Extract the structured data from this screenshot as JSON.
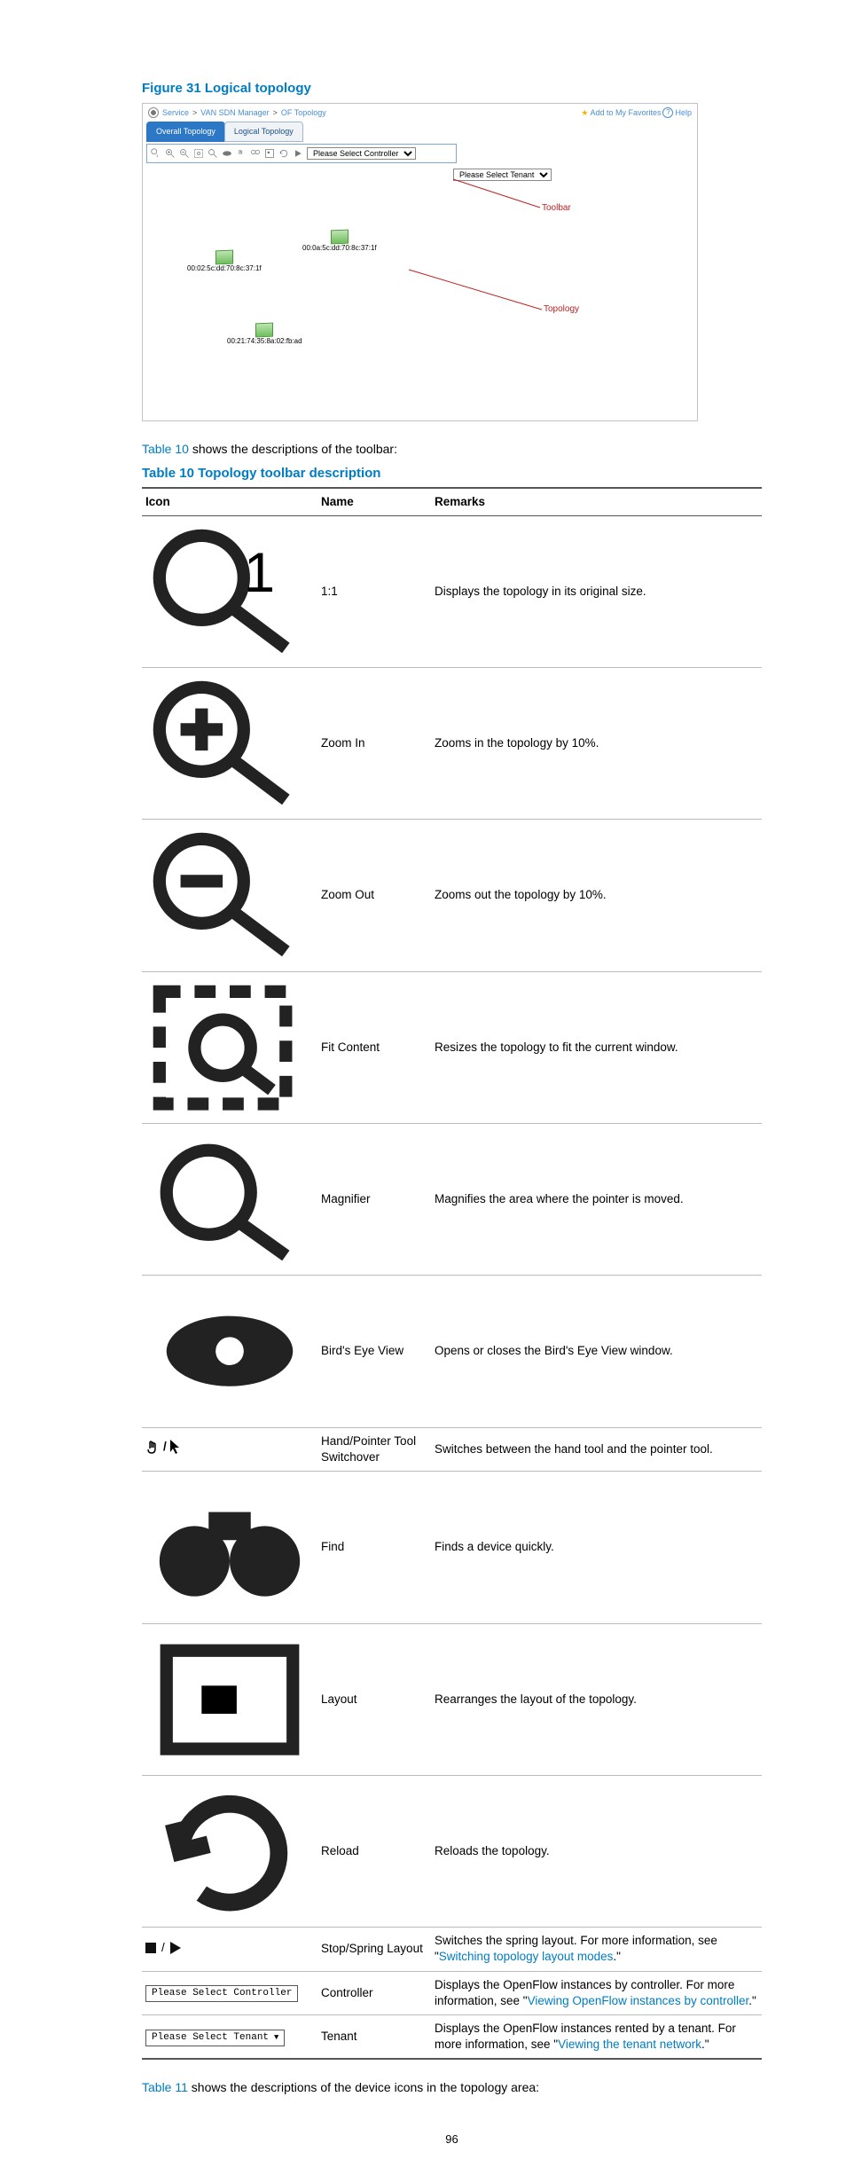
{
  "figure": {
    "label": "Figure 31 Logical topology"
  },
  "screenshot": {
    "breadcrumb": [
      "Service",
      "VAN SDN Manager",
      "OF Topology"
    ],
    "favorites_label": "Add to My Favorites",
    "help_label": "Help",
    "tabs": {
      "overall": "Overall Topology",
      "logical": "Logical Topology"
    },
    "controller_placeholder": "Please Select Controller",
    "tenant_placeholder": "Please Select Tenant",
    "nodes": {
      "a": "00:02:5c:dd:70:8c:37:1f",
      "b": "00:0a:5c:dd:70:8c:37:1f",
      "c": "00:21:74:35:8a:02:fb:ad"
    },
    "callouts": {
      "toolbar": "Toolbar",
      "topology": "Topology"
    }
  },
  "intro_para": {
    "link": "Table 10",
    "rest": " shows the descriptions of the toolbar:"
  },
  "table_title": "Table 10 Topology toolbar description",
  "table_headers": {
    "icon": "Icon",
    "name": "Name",
    "remarks": "Remarks"
  },
  "rows": [
    {
      "name": "1:1",
      "remarks": "Displays the topology in its original size."
    },
    {
      "name": "Zoom In",
      "remarks": "Zooms in the topology by 10%."
    },
    {
      "name": "Zoom Out",
      "remarks": "Zooms out the topology by 10%."
    },
    {
      "name": "Fit Content",
      "remarks": "Resizes the topology to fit the current window."
    },
    {
      "name": "Magnifier",
      "remarks": "Magnifies the area where the pointer is moved."
    },
    {
      "name": "Bird's Eye View",
      "remarks": "Opens or closes the Bird's Eye View window."
    },
    {
      "name": "Hand/Pointer Tool Switchover",
      "remarks": "Switches between the hand tool and the pointer tool."
    },
    {
      "name": "Find",
      "remarks": "Finds a device quickly."
    },
    {
      "name": "Layout",
      "remarks": "Rearranges the layout of the topology."
    },
    {
      "name": "Reload",
      "remarks": "Reloads the topology."
    },
    {
      "name": "Stop/Spring Layout",
      "remarks_pre": "Switches the spring layout. For more information, see \"",
      "remarks_link": "Switching topology layout modes",
      "remarks_post": ".\""
    },
    {
      "name": "Controller",
      "box_label": "Please Select Controller",
      "remarks_pre": "Displays the OpenFlow instances by controller. For more information, see \"",
      "remarks_link": "Viewing OpenFlow instances by controller",
      "remarks_post": ".\""
    },
    {
      "name": "Tenant",
      "box_label": "Please Select Tenant",
      "remarks_pre": "Displays the OpenFlow instances rented by a tenant. For more information, see \"",
      "remarks_link": "Viewing the tenant network",
      "remarks_post": ".\""
    }
  ],
  "outro_para": {
    "link": "Table 11",
    "rest": " shows the descriptions of the device icons in the topology area:"
  },
  "page_number": "96"
}
